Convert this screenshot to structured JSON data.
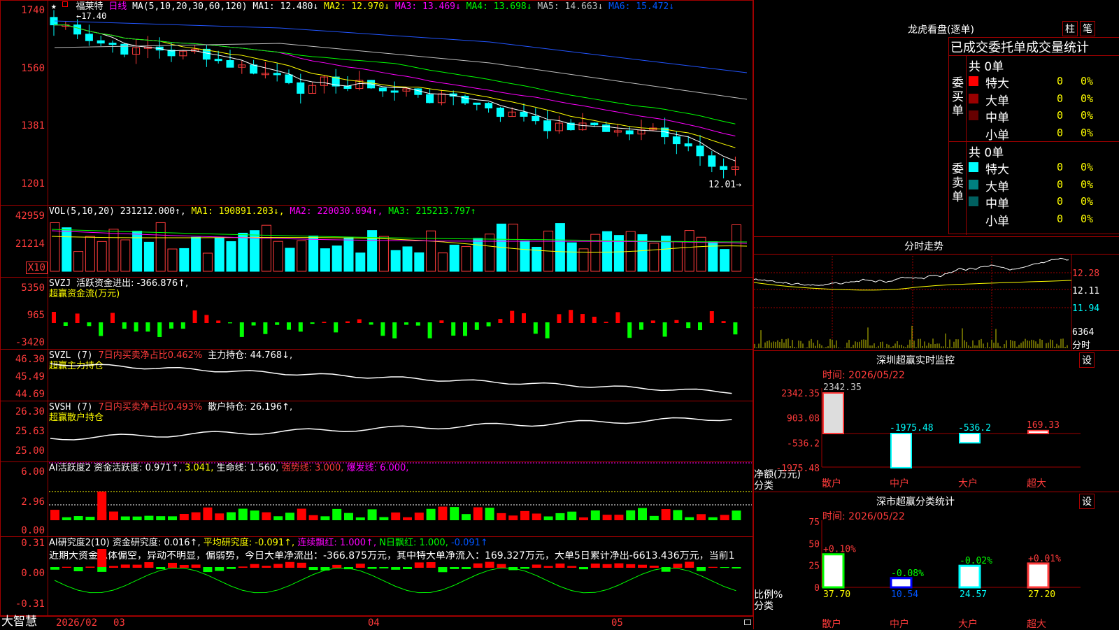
{
  "app": {
    "brand": "大智慧",
    "date_start": "2026/02",
    "months": [
      "03",
      "04",
      "05"
    ]
  },
  "main_chart": {
    "star": "★",
    "name": "福莱特",
    "period": "日线",
    "ma_def": "MA(5,10,20,30,60,120)",
    "ma_values": [
      {
        "label": "MA1: 12.480↓",
        "color": "#ffffff"
      },
      {
        "label": "MA2: 12.970↓",
        "color": "#ffff00"
      },
      {
        "label": "MA3: 13.469↓",
        "color": "#ff00ff"
      },
      {
        "label": "MA4: 13.698↓",
        "color": "#00ff00"
      },
      {
        "label": "MA5: 14.663↓",
        "color": "#c0c0c0"
      },
      {
        "label": "MA6: 15.472↓",
        "color": "#0055ff"
      }
    ],
    "high_label": "17.40",
    "last_label": "12.01→",
    "y_ticks": [
      "1740",
      "1560",
      "1381",
      "1201"
    ]
  },
  "vol_panel": {
    "title": "VOL(5,10,20)",
    "value": "231212.000↑,",
    "ma1": "MA1: 190891.203↓,",
    "ma2": "MA2: 220030.094↑,",
    "ma3": "MA3: 215213.797↑",
    "y_ticks": [
      "42959",
      "21214"
    ],
    "unit": "X10"
  },
  "svzj_panel": {
    "title": "SVZJ",
    "label": "活跃资金进出: -366.876↑,",
    "sub": "超赢资金流(万元)",
    "y_ticks": [
      "5350",
      "965",
      "-3420"
    ]
  },
  "svzl_panel": {
    "title": "SVZL (7)",
    "ratio": "7日内买卖净占比0.462%",
    "hold": "主力持仓: 44.768↓,",
    "sub": "超赢主力持仓",
    "y_ticks": [
      "46.30",
      "45.49",
      "44.69"
    ]
  },
  "svsh_panel": {
    "title": "SVSH (7)",
    "ratio": "7日内买卖净占比0.493%",
    "hold": "散户持仓: 26.196↑,",
    "sub": "超赢散户持仓",
    "y_ticks": [
      "26.30",
      "25.63",
      "25.00"
    ]
  },
  "ai1_panel": {
    "title": "AI活跃度2",
    "a": "资金活跃度: 0.971↑,",
    "b": "3.041,",
    "c": "生命线: 1.560,",
    "d": "强势线: 3.000,",
    "e": "爆发线: 6.000,",
    "y_ticks": [
      "6.00",
      "2.96",
      "0.00"
    ]
  },
  "ai2_panel": {
    "title": "AI研究度2(10)",
    "a": "资金研究度: 0.016↑,",
    "b": "平均研究度: -0.091↑,",
    "c": "连续飘红: 1.000↑,",
    "d": "N日飘红: 1.000,",
    "e": "-0.091↑",
    "text": "近期大资金总体偏空，异动不明显，偏弱势，今日大单净流出：-366.875万元，其中特大单净流入：169.327万元，大单5日累计净出-6613.436万元，当前1",
    "y_ticks": [
      "0.31",
      "0.00",
      "-0.31"
    ]
  },
  "right": {
    "lhkp_title": "龙虎看盘(逐单)",
    "btn_zhu": "柱",
    "btn_bi": "笔",
    "stat_title": "已成交委托单成交量统计",
    "buy_label": "委买单",
    "sell_label": "委卖单",
    "buy_total": "共 0单",
    "sell_total": "共 0单",
    "buy_rows": [
      {
        "name": "特大",
        "n": "0",
        "p": "0%",
        "color": "#ff0000"
      },
      {
        "name": "大单",
        "n": "0",
        "p": "0%",
        "color": "#990000"
      },
      {
        "name": "中单",
        "n": "0",
        "p": "0%",
        "color": "#660000"
      },
      {
        "name": "小单",
        "n": "0",
        "p": "0%",
        "color": "#000000"
      }
    ],
    "sell_rows": [
      {
        "name": "特大",
        "n": "0",
        "p": "0%",
        "color": "#00ffff"
      },
      {
        "name": "大单",
        "n": "0",
        "p": "0%",
        "color": "#008080"
      },
      {
        "name": "中单",
        "n": "0",
        "p": "0%",
        "color": "#006060"
      },
      {
        "name": "小单",
        "n": "0",
        "p": "0%",
        "color": "#000000"
      }
    ],
    "fs_title": "分时走势",
    "fs_ticks": [
      "12.28",
      "12.11",
      "11.94"
    ],
    "fs_vol": "6364",
    "fs_unit": "分时",
    "monitor_title": "深圳超赢实时监控",
    "monitor_btn": "设",
    "monitor_time": "时间: 2026/05/22",
    "monitor_ylabels": [
      "2342.35",
      "903.08",
      "-536.2",
      "-1975.48"
    ],
    "monitor_unit": "净额(万元)",
    "monitor_cat_label": "分类",
    "stat2_title": "深市超赢分类统计",
    "stat2_btn": "设",
    "stat2_time": "时间: 2026/05/22",
    "stat2_ylabels": [
      "75",
      "50",
      "25",
      "0"
    ],
    "stat2_unit": "比例%",
    "stat2_cat_label": "分类"
  },
  "chart_data": [
    {
      "type": "bar",
      "title": "深圳超赢实时监控",
      "categories": [
        "散户",
        "中户",
        "大户",
        "超大"
      ],
      "values": [
        2342.35,
        -1975.48,
        -536.2,
        169.33
      ],
      "labels": [
        "2342.35",
        "-1975.48",
        "-536.2",
        "169.33"
      ],
      "ylim": [
        -1975.48,
        2342.35
      ]
    },
    {
      "type": "bar",
      "title": "深市超赢分类统计",
      "categories": [
        "散户",
        "中户",
        "大户",
        "超大"
      ],
      "values": [
        37.7,
        10.54,
        24.57,
        27.2
      ],
      "change_labels": [
        "+0.10%",
        "-0.08%",
        "-0.02%",
        "+0.01%"
      ],
      "value_labels": [
        "37.70",
        "10.54",
        "24.57",
        "27.20"
      ],
      "ylim": [
        0,
        75
      ]
    }
  ]
}
